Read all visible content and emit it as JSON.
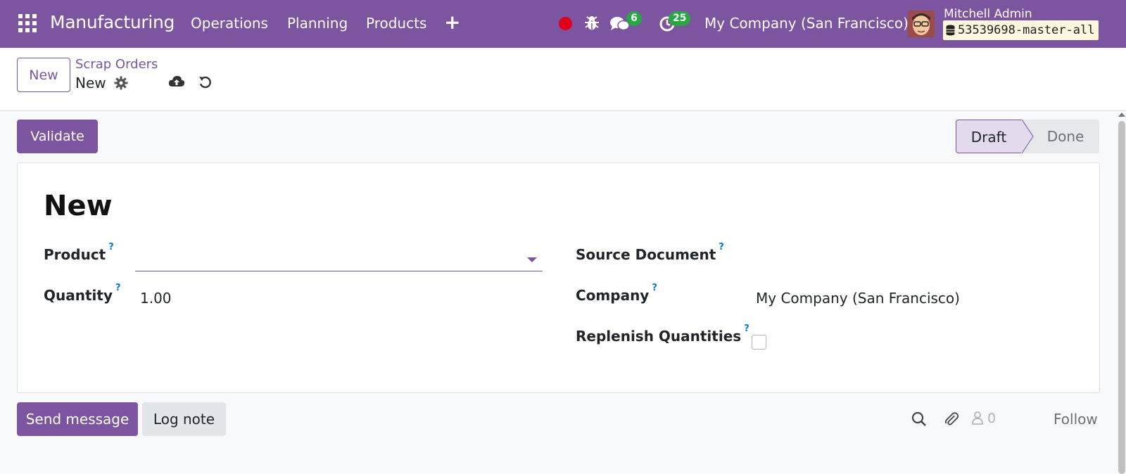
{
  "navbar": {
    "app_name": "Manufacturing",
    "menu": [
      "Operations",
      "Planning",
      "Products"
    ],
    "messages_count": "6",
    "activities_count": "25",
    "company": "My Company (San Francisco)",
    "user_name": "Mitchell Admin",
    "database": "53539698-master-all",
    "icons": [
      "apps-grid-icon",
      "plus-icon",
      "record-dot-icon",
      "bug-icon",
      "chat-icon",
      "clock-icon",
      "database-icon"
    ],
    "color": "#7c54a0"
  },
  "control_panel": {
    "new_label": "New",
    "breadcrumb_parent": "Scrap Orders",
    "breadcrumb_current": "New"
  },
  "statusbar": {
    "validate_label": "Validate",
    "stages": [
      "Draft",
      "Done"
    ],
    "active_stage": "Draft"
  },
  "form": {
    "title": "New",
    "product_label": "Product",
    "product_value": "",
    "quantity_label": "Quantity",
    "quantity_value": "1.00",
    "source_document_label": "Source Document",
    "source_document_value": "",
    "company_label": "Company",
    "company_value": "My Company (San Francisco)",
    "replenish_label": "Replenish Quantities",
    "replenish_checked": false,
    "help_mark": "?"
  },
  "chatter": {
    "send_message_label": "Send message",
    "log_note_label": "Log note",
    "followers_count": "0",
    "follow_label": "Follow"
  },
  "colors": {
    "primary": "#7c54a0",
    "badge": "#28a745",
    "record": "#e0001a",
    "help": "#0b7bc1"
  }
}
